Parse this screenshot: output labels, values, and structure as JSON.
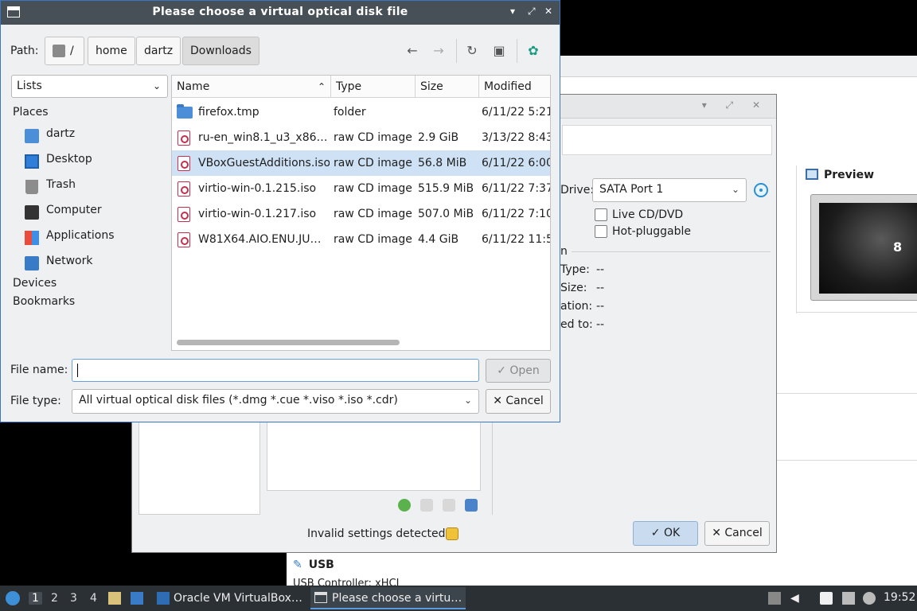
{
  "chooser": {
    "title": "Please choose a virtual optical disk file",
    "path_label": "Path:",
    "path_root": "/",
    "path_segments": [
      "home",
      "dartz",
      "Downloads"
    ],
    "view_mode": "Lists",
    "sidebar": {
      "places_header": "Places",
      "items": [
        "dartz",
        "Desktop",
        "Trash",
        "Computer",
        "Applications",
        "Network"
      ],
      "devices_header": "Devices",
      "bookmarks_header": "Bookmarks"
    },
    "columns": [
      "Name",
      "Type",
      "Size",
      "Modified"
    ],
    "files": [
      {
        "name": "firefox.tmp",
        "type": "folder",
        "size": "",
        "modified": "6/11/22 5:21",
        "icon": "folder-icon"
      },
      {
        "name": "ru-en_win8.1_u3_x86…",
        "type": "raw CD image",
        "size": "2.9 GiB",
        "modified": "3/13/22 8:43",
        "icon": "disc-image-icon"
      },
      {
        "name": "VBoxGuestAdditions.iso",
        "type": "raw CD image",
        "size": "56.8 MiB",
        "modified": "6/11/22 6:00",
        "icon": "disc-image-icon"
      },
      {
        "name": "virtio-win-0.1.215.iso",
        "type": "raw CD image",
        "size": "515.9 MiB",
        "modified": "6/11/22 7:37",
        "icon": "disc-image-icon"
      },
      {
        "name": "virtio-win-0.1.217.iso",
        "type": "raw CD image",
        "size": "507.0 MiB",
        "modified": "6/11/22 7:10",
        "icon": "disc-image-icon"
      },
      {
        "name": "W81X64.AIO.ENU.JU…",
        "type": "raw CD image",
        "size": "4.4 GiB",
        "modified": "6/11/22 11:5",
        "icon": "disc-image-icon"
      }
    ],
    "selected_file": "VBoxGuestAdditions.iso",
    "file_name_label": "File name:",
    "file_name_value": "",
    "file_type_label": "File type:",
    "file_type_value": "All virtual optical disk files (*.dmg *.cue *.viso *.iso *.cdr)",
    "open_button": "Open",
    "cancel_button": "Cancel"
  },
  "settings_dialog": {
    "drive_label": "Drive:",
    "drive_value": "SATA Port 1",
    "live_cd": "Live CD/DVD",
    "hot_pluggable": "Hot-pluggable",
    "info_header_fragment": "n",
    "info_labels": [
      "Type:",
      "Size:",
      "ation:",
      "ed to:"
    ],
    "info_values": [
      "--",
      "--",
      "--",
      "--"
    ],
    "status_text": "Invalid settings detected",
    "ok_button": "OK",
    "cancel_button": "Cancel"
  },
  "main_window": {
    "preview_title": "Preview",
    "preview_number": "8",
    "usb_title": "USB",
    "usb_sub": "USB Controller:   xHCI"
  },
  "taskbar": {
    "workspaces": [
      "1",
      "2",
      "3",
      "4"
    ],
    "current_workspace": "1",
    "tasks": [
      "Oracle VM VirtualBox…",
      "Please choose a virtu…"
    ],
    "clock": "19:52"
  },
  "colors": {
    "accent": "#3b77c4",
    "selection": "#cfe2f5",
    "titlebar": "#475057",
    "taskbar": "#2b3035"
  }
}
